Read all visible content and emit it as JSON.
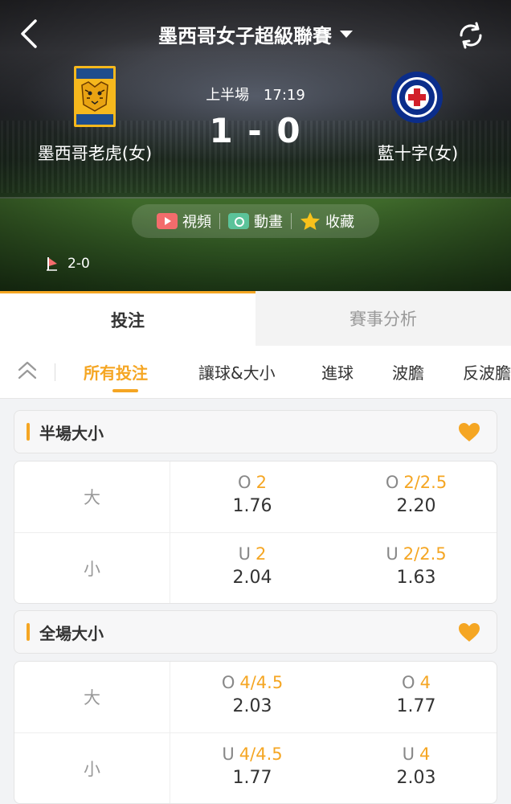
{
  "header": {
    "league": "墨西哥女子超級聯賽",
    "home_team": "墨西哥老虎(女)",
    "away_team": "藍十字(女)",
    "home_logo_text_top": "TIGRES",
    "home_logo_text_bottom": "UANL",
    "period": "上半場",
    "clock": "17:19",
    "score": "1 - 0",
    "actions": {
      "video": "視頻",
      "animation": "動畫",
      "favorite": "收藏"
    },
    "corners": "2-0"
  },
  "main_tabs": [
    {
      "label": "投注",
      "active": true
    },
    {
      "label": "賽事分析",
      "active": false
    }
  ],
  "sub_tabs": [
    {
      "label": "所有投注",
      "active": true
    },
    {
      "label": "讓球&大小",
      "active": false
    },
    {
      "label": "進球",
      "active": false
    },
    {
      "label": "波膽",
      "active": false
    },
    {
      "label": "反波膽",
      "active": false
    }
  ],
  "markets": [
    {
      "title": "半場大小",
      "rows": [
        {
          "label": "大",
          "cells": [
            {
              "side": "O",
              "line": "2",
              "price": "1.76"
            },
            {
              "side": "O",
              "line": "2/2.5",
              "price": "2.20"
            }
          ]
        },
        {
          "label": "小",
          "cells": [
            {
              "side": "U",
              "line": "2",
              "price": "2.04"
            },
            {
              "side": "U",
              "line": "2/2.5",
              "price": "1.63"
            }
          ]
        }
      ]
    },
    {
      "title": "全場大小",
      "rows": [
        {
          "label": "大",
          "cells": [
            {
              "side": "O",
              "line": "4/4.5",
              "price": "2.03"
            },
            {
              "side": "O",
              "line": "4",
              "price": "1.77"
            }
          ]
        },
        {
          "label": "小",
          "cells": [
            {
              "side": "U",
              "line": "4/4.5",
              "price": "1.77"
            },
            {
              "side": "U",
              "line": "4",
              "price": "2.03"
            }
          ]
        }
      ]
    }
  ],
  "icons": {
    "back": "back-icon",
    "refresh": "refresh-icon",
    "caret": "caret-down-icon",
    "collapse": "chevron-double-up-icon",
    "favorite": "heart-icon",
    "corner": "corner-flag-icon"
  },
  "colors": {
    "accent": "#f5a623",
    "video": "#f36c6c",
    "animation": "#5bc39a",
    "star": "#f7c21b"
  }
}
